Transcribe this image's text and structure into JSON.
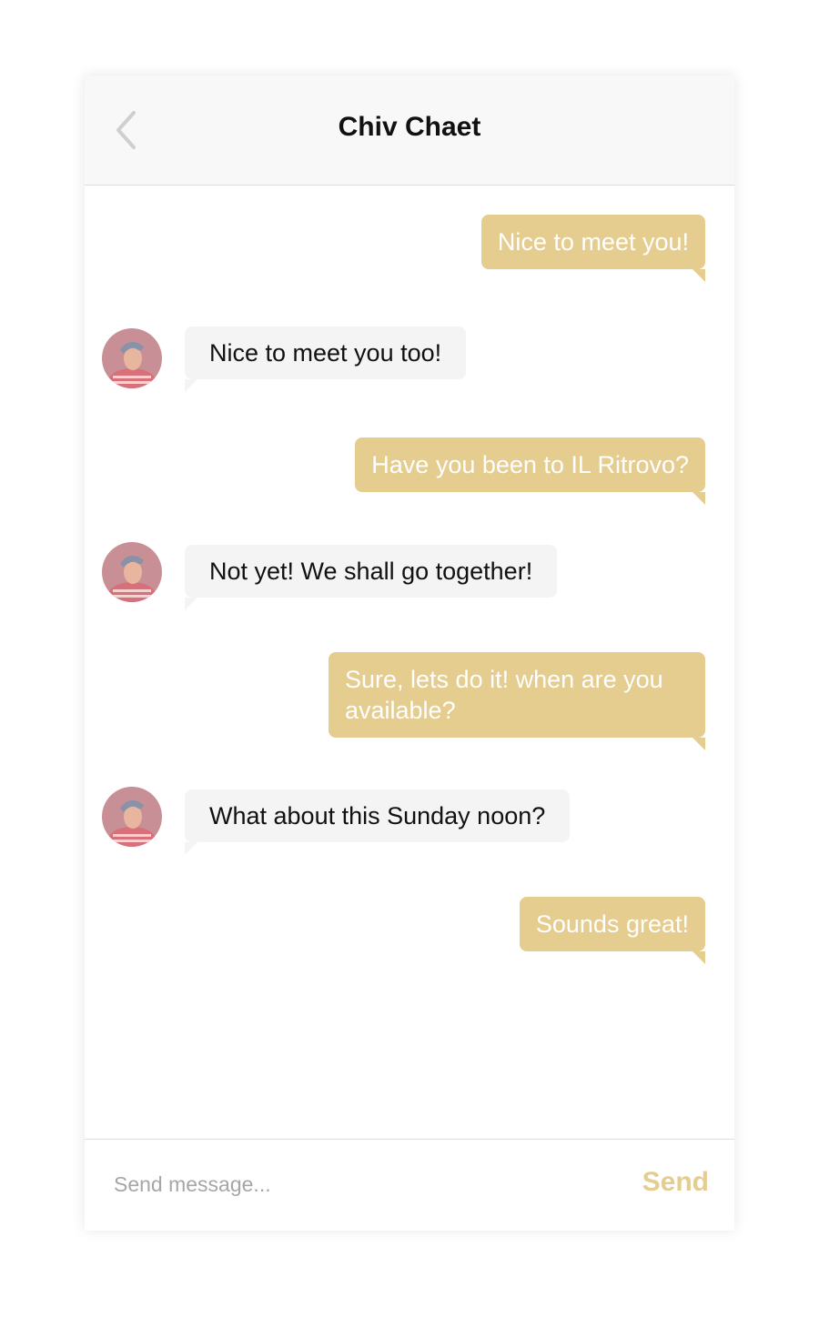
{
  "header": {
    "title": "Chiv Chaet",
    "back_icon": "chevron-left-icon"
  },
  "messages": [
    {
      "direction": "sent",
      "text": "Nice to meet you!"
    },
    {
      "direction": "received",
      "text": "Nice to meet you too!"
    },
    {
      "direction": "sent",
      "text": "Have you been to IL Ritrovo?"
    },
    {
      "direction": "received",
      "text": "Not yet! We shall go together!"
    },
    {
      "direction": "sent",
      "text": "Sure, lets do it! when are you available?"
    },
    {
      "direction": "received",
      "text": "What about this Sunday noon?"
    },
    {
      "direction": "sent",
      "text": "Sounds great!"
    }
  ],
  "composer": {
    "placeholder": "Send message...",
    "value": "",
    "send_label": "Send"
  },
  "colors": {
    "accent": "#e5cc8f",
    "received_bubble": "#f4f4f4",
    "header_bg": "#f8f8f8"
  }
}
